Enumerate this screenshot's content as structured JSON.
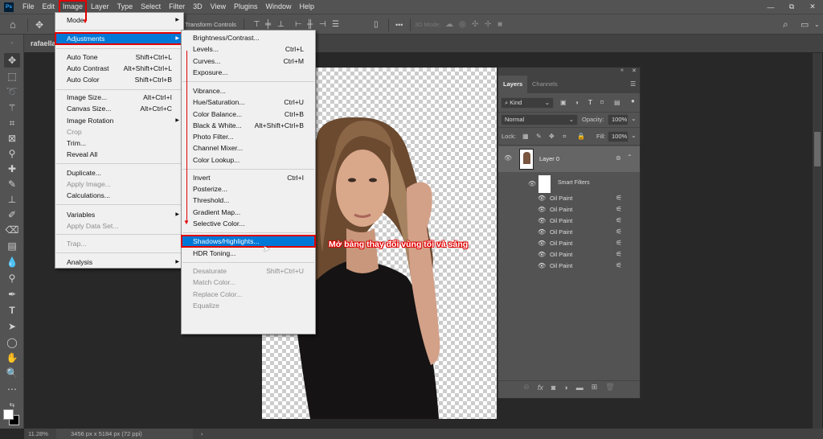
{
  "app": {
    "logo": "Ps"
  },
  "menubar": {
    "items": [
      "File",
      "Edit",
      "Image",
      "Layer",
      "Type",
      "Select",
      "Filter",
      "3D",
      "View",
      "Plugins",
      "Window",
      "Help"
    ],
    "active": "Image"
  },
  "window_controls": {
    "minimize": "—",
    "restore": "⧉",
    "close": "✕"
  },
  "optionsbar": {
    "transform_controls": "Transform Controls",
    "more": "•••",
    "mode_3d": "3D Mode:"
  },
  "document": {
    "tab_name": "rafaella",
    "zoom": "11.28%",
    "info": "3456 px x 5184 px (72 ppi)"
  },
  "image_menu": {
    "items": [
      {
        "label": "Mode",
        "submenu": true
      },
      {
        "label": "Adjustments",
        "submenu": true,
        "highlighted": true
      },
      {
        "label": "Auto Tone",
        "shortcut": "Shift+Ctrl+L"
      },
      {
        "label": "Auto Contrast",
        "shortcut": "Alt+Shift+Ctrl+L"
      },
      {
        "label": "Auto Color",
        "shortcut": "Shift+Ctrl+B"
      },
      {
        "label": "Image Size...",
        "shortcut": "Alt+Ctrl+I"
      },
      {
        "label": "Canvas Size...",
        "shortcut": "Alt+Ctrl+C"
      },
      {
        "label": "Image Rotation",
        "submenu": true
      },
      {
        "label": "Crop",
        "disabled": true
      },
      {
        "label": "Trim..."
      },
      {
        "label": "Reveal All"
      },
      {
        "label": "Duplicate..."
      },
      {
        "label": "Apply Image...",
        "disabled": true
      },
      {
        "label": "Calculations..."
      },
      {
        "label": "Variables",
        "submenu": true
      },
      {
        "label": "Apply Data Set...",
        "disabled": true
      },
      {
        "label": "Trap...",
        "disabled": true
      },
      {
        "label": "Analysis",
        "submenu": true
      }
    ]
  },
  "adjustments_menu": {
    "items": [
      {
        "label": "Brightness/Contrast..."
      },
      {
        "label": "Levels...",
        "shortcut": "Ctrl+L"
      },
      {
        "label": "Curves...",
        "shortcut": "Ctrl+M"
      },
      {
        "label": "Exposure..."
      },
      {
        "label": "Vibrance..."
      },
      {
        "label": "Hue/Saturation...",
        "shortcut": "Ctrl+U"
      },
      {
        "label": "Color Balance...",
        "shortcut": "Ctrl+B"
      },
      {
        "label": "Black & White...",
        "shortcut": "Alt+Shift+Ctrl+B"
      },
      {
        "label": "Photo Filter..."
      },
      {
        "label": "Channel Mixer..."
      },
      {
        "label": "Color Lookup..."
      },
      {
        "label": "Invert",
        "shortcut": "Ctrl+I"
      },
      {
        "label": "Posterize..."
      },
      {
        "label": "Threshold..."
      },
      {
        "label": "Gradient Map..."
      },
      {
        "label": "Selective Color..."
      },
      {
        "label": "Shadows/Highlights...",
        "highlighted": true
      },
      {
        "label": "HDR Toning..."
      },
      {
        "label": "Desaturate",
        "shortcut": "Shift+Ctrl+U",
        "disabled": true
      },
      {
        "label": "Match Color...",
        "disabled": true
      },
      {
        "label": "Replace Color...",
        "disabled": true
      },
      {
        "label": "Equalize",
        "disabled": true
      }
    ]
  },
  "annotation": {
    "text": "Mở bảng thay đổi vùng tối và sáng",
    "color": "#e00000"
  },
  "layers_panel": {
    "tabs": [
      "Layers",
      "Channels"
    ],
    "active_tab": "Layers",
    "filter_kind": "Kind",
    "blend_mode": "Normal",
    "opacity_label": "Opacity:",
    "opacity": "100%",
    "lock_label": "Lock:",
    "fill_label": "Fill:",
    "fill": "100%",
    "layer_name": "Layer 0",
    "smart_filters_label": "Smart Filters",
    "filters": [
      "Oil Paint",
      "Oil Paint",
      "Oil Paint",
      "Oil Paint",
      "Oil Paint",
      "Oil Paint",
      "Oil Paint"
    ]
  },
  "colors": {
    "highlight": "#0078d7",
    "annotation_red": "#e00000",
    "ui_dark": "#535353"
  }
}
